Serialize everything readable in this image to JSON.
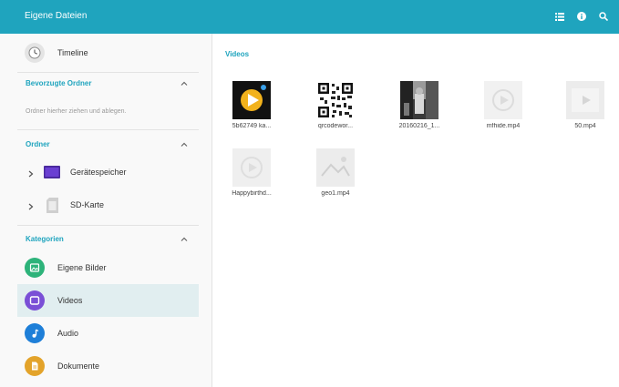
{
  "header": {
    "title": "Eigene Dateien",
    "actions": [
      "list-view-icon",
      "info-icon",
      "search-icon"
    ],
    "color": "#1fa4be"
  },
  "sidebar": {
    "timeline": {
      "label": "Timeline",
      "icon": "clock-icon"
    },
    "favorites": {
      "title": "Bevorzugte Ordner",
      "hint": "Ordner hierher ziehen und ablegen."
    },
    "folders": {
      "title": "Ordner",
      "items": [
        {
          "label": "Gerätespeicher",
          "icon": "device-storage-folder-icon"
        },
        {
          "label": "SD-Karte",
          "icon": "sd-card-icon"
        }
      ]
    },
    "categories": {
      "title": "Kategorien",
      "items": [
        {
          "label": "Eigene Bilder",
          "icon": "image-icon",
          "color": "#2db37a"
        },
        {
          "label": "Videos",
          "icon": "video-icon",
          "color": "#7a4fd6",
          "selected": true
        },
        {
          "label": "Audio",
          "icon": "music-icon",
          "color": "#1e7fd8"
        },
        {
          "label": "Dokumente",
          "icon": "document-icon",
          "color": "#e3a32a"
        }
      ]
    }
  },
  "main": {
    "title": "Videos",
    "files": [
      {
        "name": "5b62749 ka...",
        "thumb": "play-thumbnail"
      },
      {
        "name": "qrcodewor...",
        "thumb": "qr-code-thumbnail"
      },
      {
        "name": "20160216_1...",
        "thumb": "photo-thumbnail"
      },
      {
        "name": "mfhide.mp4",
        "thumb": "video-placeholder"
      },
      {
        "name": "50.mp4",
        "thumb": "video-placeholder"
      },
      {
        "name": "Happybirthd...",
        "thumb": "video-placeholder"
      },
      {
        "name": "geo1.mp4",
        "thumb": "video-placeholder"
      }
    ]
  }
}
